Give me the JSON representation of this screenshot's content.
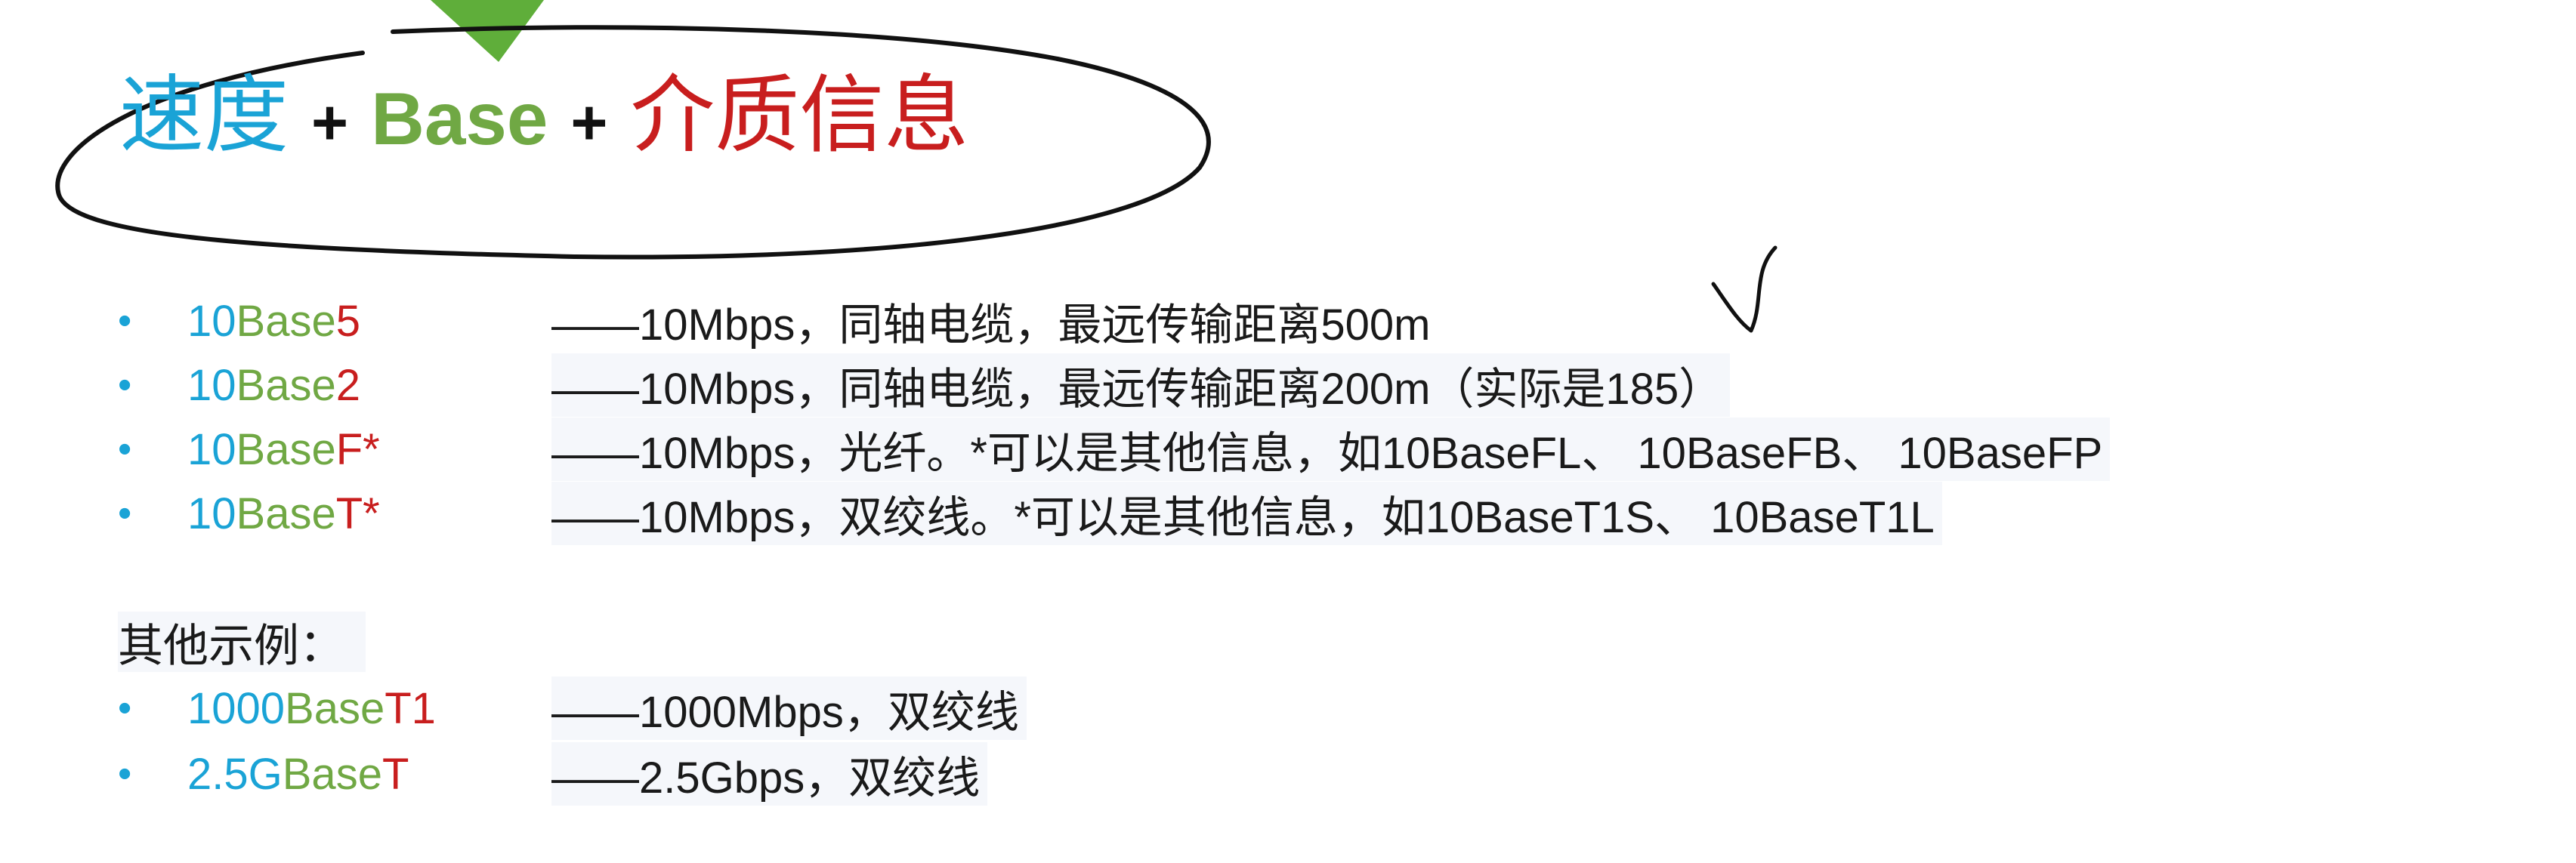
{
  "title": {
    "speed": "速度",
    "plus1": "+",
    "base": "Base",
    "plus2": "+",
    "medium": "介质信息"
  },
  "items": [
    {
      "prefix": "10",
      "base": "Base",
      "suffix": "5",
      "desc": "——10Mbps，同轴电缆，最远传输距离500m"
    },
    {
      "prefix": "10",
      "base": "Base",
      "suffix": "2",
      "desc": "——10Mbps，同轴电缆，最远传输距离200m（实际是185）"
    },
    {
      "prefix": "10",
      "base": "Base",
      "suffix": "F*",
      "desc": "——10Mbps，光纤。*可以是其他信息，如10BaseFL、 10BaseFB、 10BaseFP"
    },
    {
      "prefix": "10",
      "base": "Base",
      "suffix": "T*",
      "desc": "——10Mbps，双绞线。*可以是其他信息，如10BaseT1S、 10BaseT1L"
    }
  ],
  "other_label": "其他示例：",
  "other_items": [
    {
      "prefix": "1000",
      "base": "Base",
      "suffix": "T1",
      "desc": "——1000Mbps，双绞线"
    },
    {
      "prefix": "2.5G",
      "base": "Base",
      "suffix": "T",
      "desc": "——2.5Gbps，双绞线"
    }
  ],
  "colors": {
    "speed": "#1aa3d6",
    "base": "#70a844",
    "medium": "#c81e1e",
    "bullet": "#1aa3d6",
    "pointer": "#5fae3a"
  },
  "annotations": {
    "ellipse": "hand-drawn-ellipse",
    "checkmark": "hand-drawn-check",
    "pointer": "triangle-pointer"
  }
}
